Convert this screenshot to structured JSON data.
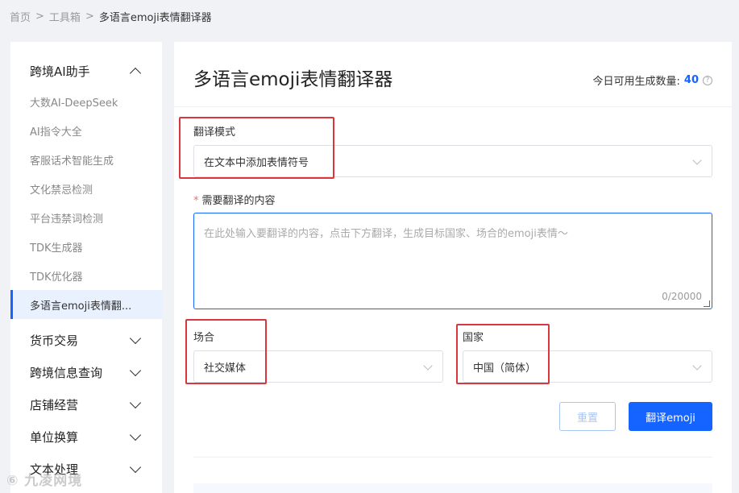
{
  "breadcrumb": {
    "home": "首页",
    "toolbox": "工具箱",
    "current": "多语言emoji表情翻译器",
    "separator": ">"
  },
  "sidebar": {
    "group_ai": "跨境AI助手",
    "ai_items": [
      "大数AI-DeepSeek",
      "AI指令大全",
      "客服话术智能生成",
      "文化禁忌检测",
      "平台违禁词检测",
      "TDK生成器",
      "TDK优化器",
      "多语言emoji表情翻..."
    ],
    "groups": [
      "货币交易",
      "跨境信息查询",
      "店铺经营",
      "单位换算",
      "文本处理"
    ]
  },
  "main": {
    "title": "多语言emoji表情翻译器",
    "quota_label": "今日可用生成数量:",
    "quota_value": "40",
    "help_glyph": "?"
  },
  "form": {
    "mode_label": "翻译模式",
    "mode_value": "在文本中添加表情符号",
    "content_required": "*",
    "content_label": "需要翻译的内容",
    "content_placeholder": "在此处输入要翻译的内容，点击下方翻译，生成目标国家、场合的emoji表情～",
    "content_counter": "0/20000",
    "scene_label": "场合",
    "scene_value": "社交媒体",
    "country_label": "国家",
    "country_value": "中国（简体）",
    "reset_label": "重置",
    "submit_label": "翻译emoji"
  },
  "colors": {
    "accent": "#1664ff",
    "highlight": "#d9363e",
    "active_bg": "#e8f1fd"
  },
  "watermark": "⑥ 九凌网境"
}
